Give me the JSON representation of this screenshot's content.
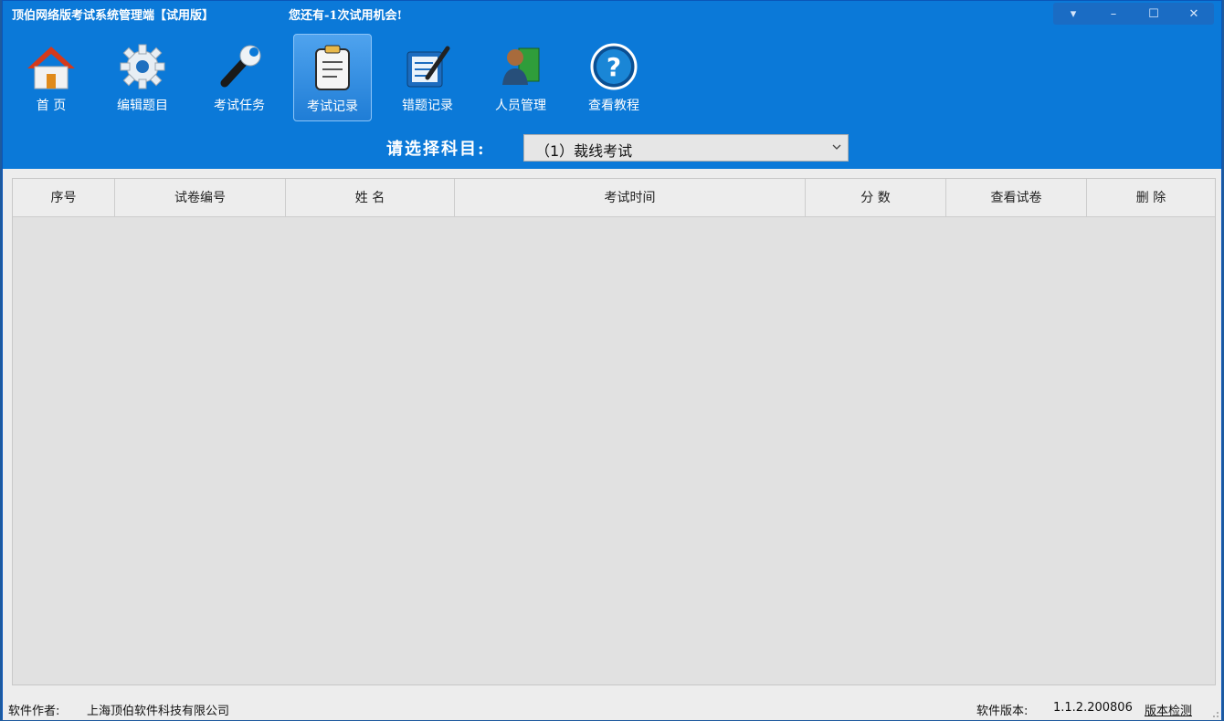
{
  "window": {
    "title": "顶伯网络版考试系统管理端【试用版】",
    "trial_notice": "您还有-1次试用机会!",
    "controls": {
      "menu": "▾",
      "minimize": "–",
      "maximize": "☐",
      "close": "✕"
    }
  },
  "toolbar": {
    "items": [
      {
        "label": "首  页",
        "icon": "home-icon"
      },
      {
        "label": "编辑题目",
        "icon": "gear-icon"
      },
      {
        "label": "考试任务",
        "icon": "wrench-icon"
      },
      {
        "label": "考试记录",
        "icon": "clipboard-icon",
        "active": true
      },
      {
        "label": "错题记录",
        "icon": "notebook-pen-icon"
      },
      {
        "label": "人员管理",
        "icon": "person-book-icon"
      },
      {
        "label": "查看教程",
        "icon": "help-icon"
      }
    ]
  },
  "subject": {
    "label": "请选择科目:",
    "selected": "（1）裁线考试"
  },
  "table": {
    "columns": [
      "序号",
      "试卷编号",
      "姓  名",
      "考试时间",
      "分  数",
      "查看试卷",
      "删  除"
    ],
    "rows": []
  },
  "status": {
    "author_label": "软件作者:",
    "author": "上海顶伯软件科技有限公司",
    "version_label": "软件版本:",
    "version": "1.1.2.200806",
    "check_label": "版本检测"
  },
  "colors": {
    "header_blue": "#0b79d8",
    "active_tab": "#3a94e6",
    "grid_bg": "#e1e1e1"
  }
}
